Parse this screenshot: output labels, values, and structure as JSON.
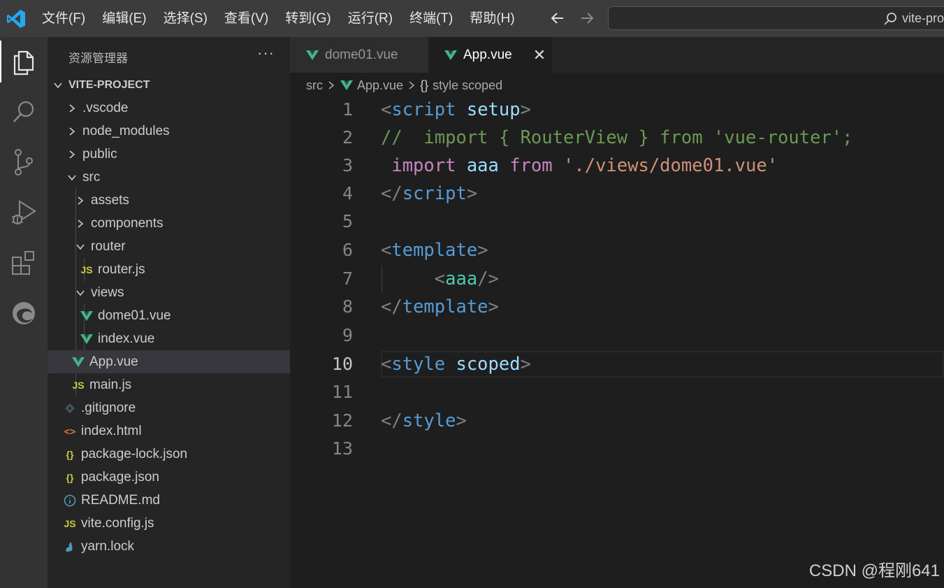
{
  "titlebar": {
    "menu": [
      "文件(F)",
      "编辑(E)",
      "选择(S)",
      "查看(V)",
      "转到(G)",
      "运行(R)",
      "终端(T)",
      "帮助(H)"
    ],
    "search_text": "vite-pro"
  },
  "activity_bar": {
    "icons": [
      "explorer-icon",
      "search-icon",
      "source-control-icon",
      "run-debug-icon",
      "extensions-icon",
      "edge-icon"
    ]
  },
  "sidebar": {
    "title": "资源管理器",
    "more": "···",
    "project": "VITE-PROJECT",
    "items": [
      {
        "label": ".vscode",
        "type": "folder",
        "expanded": false
      },
      {
        "label": "node_modules",
        "type": "folder",
        "expanded": false
      },
      {
        "label": "public",
        "type": "folder",
        "expanded": false
      },
      {
        "label": "src",
        "type": "folder",
        "expanded": true
      },
      {
        "label": "assets",
        "type": "folder",
        "expanded": false
      },
      {
        "label": "components",
        "type": "folder",
        "expanded": false
      },
      {
        "label": "router",
        "type": "folder",
        "expanded": true
      },
      {
        "label": "router.js",
        "type": "js"
      },
      {
        "label": "views",
        "type": "folder",
        "expanded": true
      },
      {
        "label": "dome01.vue",
        "type": "vue"
      },
      {
        "label": "index.vue",
        "type": "vue"
      },
      {
        "label": "App.vue",
        "type": "vue",
        "selected": true
      },
      {
        "label": "main.js",
        "type": "js"
      },
      {
        "label": ".gitignore",
        "type": "git"
      },
      {
        "label": "index.html",
        "type": "html"
      },
      {
        "label": "package-lock.json",
        "type": "json"
      },
      {
        "label": "package.json",
        "type": "json"
      },
      {
        "label": "README.md",
        "type": "info"
      },
      {
        "label": "vite.config.js",
        "type": "js"
      },
      {
        "label": "yarn.lock",
        "type": "yarn"
      }
    ],
    "js_badge": "JS",
    "json_badge": "{}",
    "html_badge": "<>"
  },
  "tabs": [
    {
      "label": "dome01.vue",
      "active": false
    },
    {
      "label": "App.vue",
      "active": true
    }
  ],
  "tab_close": "✕",
  "breadcrumb": {
    "src": "src",
    "file": "App.vue",
    "symbol_icon": "{}",
    "symbol": "style scoped"
  },
  "editor": {
    "active_line": 10,
    "lines": [
      {
        "n": "1"
      },
      {
        "n": "2"
      },
      {
        "n": "3"
      },
      {
        "n": "4"
      },
      {
        "n": "5"
      },
      {
        "n": "6"
      },
      {
        "n": "7"
      },
      {
        "n": "8"
      },
      {
        "n": "9"
      },
      {
        "n": "10"
      },
      {
        "n": "11"
      },
      {
        "n": "12"
      },
      {
        "n": "13"
      }
    ],
    "code": {
      "l1_open": "<",
      "l1_tag": "script",
      "l1_attr": " setup",
      "l1_close": ">",
      "l2": "//  import { RouterView } from 'vue-router';",
      "l3_kw1": " import",
      "l3_var": " aaa",
      "l3_kw2": " from",
      "l3_str": " './views/dome01.vue'",
      "l4_open": "</",
      "l4_tag": "script",
      "l4_close": ">",
      "l6_open": "<",
      "l6_tag": "template",
      "l6_close": ">",
      "l7_indent": "    ",
      "l7_open": " <",
      "l7_tag": "aaa",
      "l7_close": "/>",
      "l8_open": "</",
      "l8_tag": "template",
      "l8_close": ">",
      "l10_open": "<",
      "l10_tag": "style",
      "l10_attr": " scoped",
      "l10_close": ">",
      "l12_open": "</",
      "l12_tag": "style",
      "l12_close": ">"
    }
  },
  "colors": {
    "vue_green": "#41b883",
    "js_yellow": "#cbcb41",
    "json_yellow": "#cbcb41",
    "html_orange": "#e37933"
  },
  "watermark": "CSDN @程刚641"
}
